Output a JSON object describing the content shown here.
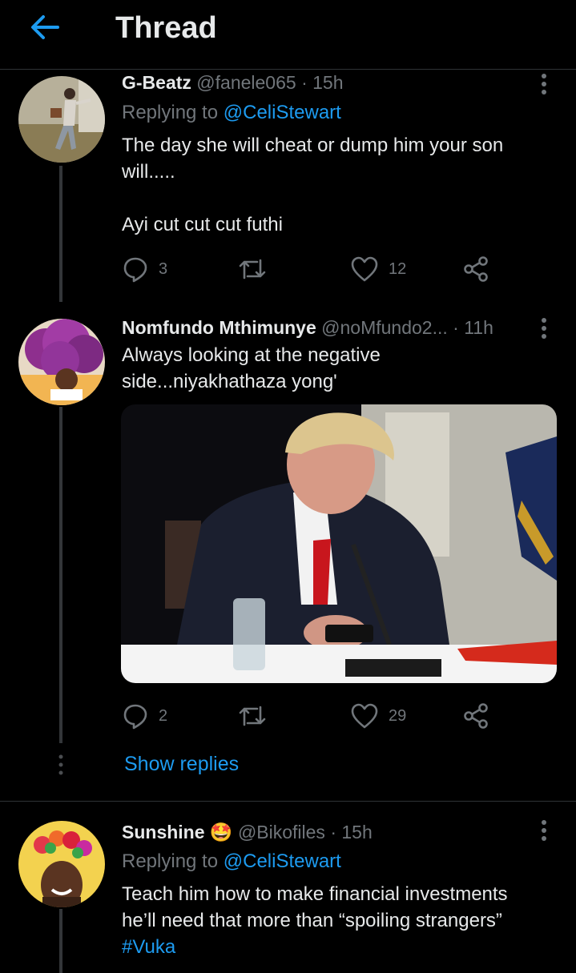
{
  "header": {
    "title": "Thread"
  },
  "tweets": [
    {
      "name": "G-Beatz",
      "handle": "@fanele065",
      "sep": " · ",
      "time": "15h",
      "replying_label": "Replying to ",
      "replying_to": "@CeliStewart",
      "text": "The day she will cheat or dump him your son will.....\n\nAyi cut cut cut futhi",
      "replies": "3",
      "retweets": "",
      "likes": "12"
    },
    {
      "name": "Nomfundo Mthimunye",
      "handle": "@noMfundo2...",
      "sep": " · ",
      "time": "11h",
      "text": "Always looking at the negative side...niyakhathaza yong'",
      "replies": "2",
      "retweets": "",
      "likes": "29",
      "show_replies": "Show replies"
    },
    {
      "name": "Sunshine",
      "name_emoji": "🤩",
      "handle": "@Bikofiles",
      "sep": " · ",
      "time": "15h",
      "replying_label": "Replying to ",
      "replying_to": "@CeliStewart",
      "text": "Teach him how to make financial investments he’ll need that more than “spoiling strangers”",
      "hashtag": "#Vuka"
    }
  ],
  "colors": {
    "accent": "#1d9bf0",
    "muted": "#71767b",
    "background": "#000000"
  }
}
